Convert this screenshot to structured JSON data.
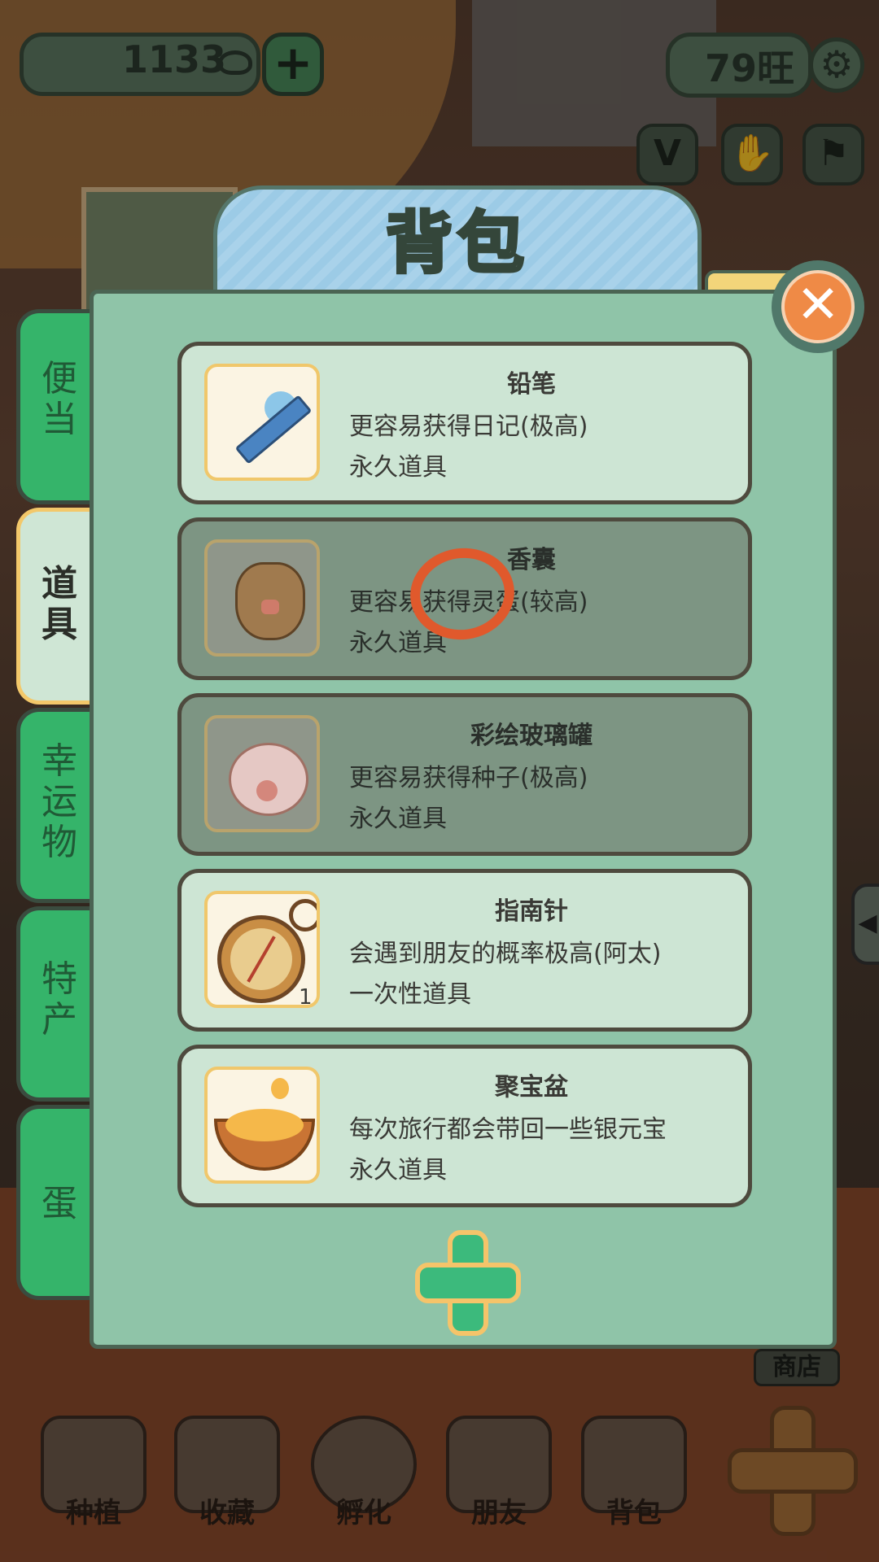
{
  "hud": {
    "coins": "1133",
    "wang": "79旺",
    "coin_plus": "+",
    "settings_glyph": "⚙"
  },
  "panel": {
    "title": "背包",
    "close_glyph": "✕"
  },
  "tabs": [
    {
      "label": "便当",
      "active": false
    },
    {
      "label": "道具",
      "active": true
    },
    {
      "label": "幸运物",
      "active": false
    },
    {
      "label": "特产",
      "active": false
    },
    {
      "label": "蛋",
      "active": false
    }
  ],
  "items": [
    {
      "name": "铅笔",
      "desc": "更容易获得日记(极高)",
      "type": "永久道具",
      "icon": "pencil-icon",
      "dimmed": false
    },
    {
      "name": "香囊",
      "desc": "更容易获得灵蛋(较高)",
      "type": "永久道具",
      "icon": "sachet-icon",
      "dimmed": true
    },
    {
      "name": "彩绘玻璃罐",
      "desc": "更容易获得种子(极高)",
      "type": "永久道具",
      "icon": "jar-icon",
      "dimmed": true
    },
    {
      "name": "指南针",
      "desc": "会遇到朋友的概率极高(阿太)",
      "type": "一次性道具",
      "icon": "compass-icon",
      "count": "1",
      "dimmed": false
    },
    {
      "name": "聚宝盆",
      "desc": "每次旅行都会带回一些银元宝",
      "type": "永久道具",
      "icon": "bowl-icon",
      "dimmed": false
    }
  ],
  "nav": [
    {
      "label": "种植",
      "icon": "planting-icon"
    },
    {
      "label": "收藏",
      "icon": "collection-icon"
    },
    {
      "label": "孵化",
      "icon": "hatch-icon"
    },
    {
      "label": "朋友",
      "icon": "friends-icon"
    },
    {
      "label": "背包",
      "icon": "backpack-icon"
    }
  ],
  "shop_label": "商店"
}
